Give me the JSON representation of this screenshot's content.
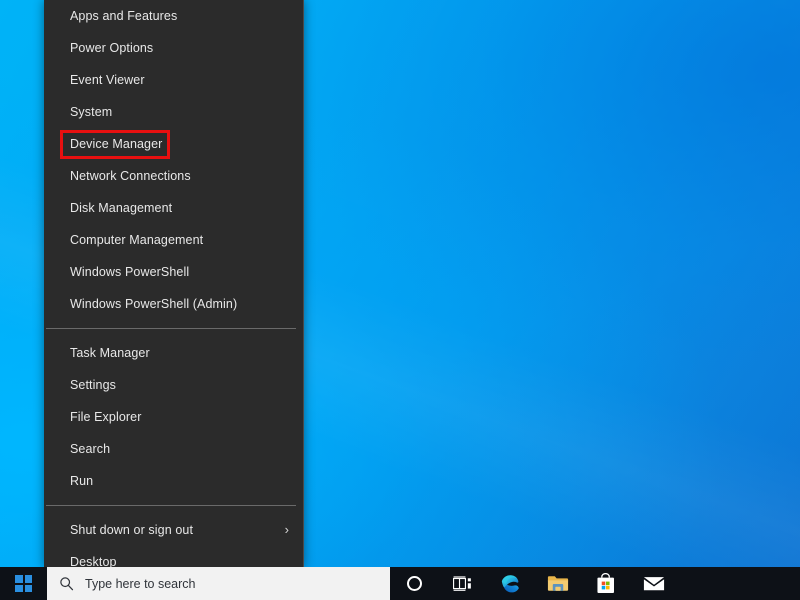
{
  "desktop": {
    "wallpaper_name": "windows-10-blue-gradient-wallpaper",
    "colors": {
      "bright_blue": "#00b3f7",
      "mid_blue": "#0498ec",
      "deep_blue": "#0f79d8"
    }
  },
  "winx_menu": {
    "name": "power-user-menu",
    "background_color": "#2b2b2b",
    "text_color": "#e8e8e8",
    "highlight": {
      "target_label": "Device Manager",
      "color": "#e81010",
      "border_width_px": 3
    },
    "groups": [
      {
        "items": [
          {
            "label": "Apps and Features",
            "has_submenu": false
          },
          {
            "label": "Power Options",
            "has_submenu": false
          },
          {
            "label": "Event Viewer",
            "has_submenu": false
          },
          {
            "label": "System",
            "has_submenu": false
          },
          {
            "label": "Device Manager",
            "has_submenu": false,
            "highlighted": true
          },
          {
            "label": "Network Connections",
            "has_submenu": false
          },
          {
            "label": "Disk Management",
            "has_submenu": false
          },
          {
            "label": "Computer Management",
            "has_submenu": false
          },
          {
            "label": "Windows PowerShell",
            "has_submenu": false
          },
          {
            "label": "Windows PowerShell (Admin)",
            "has_submenu": false
          }
        ]
      },
      {
        "items": [
          {
            "label": "Task Manager",
            "has_submenu": false
          },
          {
            "label": "Settings",
            "has_submenu": false
          },
          {
            "label": "File Explorer",
            "has_submenu": false
          },
          {
            "label": "Search",
            "has_submenu": false
          },
          {
            "label": "Run",
            "has_submenu": false
          }
        ]
      },
      {
        "items": [
          {
            "label": "Shut down or sign out",
            "has_submenu": true,
            "submenu_glyph": "›"
          },
          {
            "label": "Desktop",
            "has_submenu": false
          }
        ]
      }
    ]
  },
  "taskbar": {
    "background_color": "#0d1117",
    "start_button": {
      "icon": "windows-logo-icon",
      "label": "Start"
    },
    "search": {
      "icon": "search-icon",
      "placeholder": "Type here to search",
      "value": "",
      "background_color": "#f2f2f2"
    },
    "icons": [
      {
        "name": "cortana-icon",
        "label": "Cortana"
      },
      {
        "name": "task-view-icon",
        "label": "Task View"
      },
      {
        "name": "microsoft-edge-icon",
        "label": "Microsoft Edge"
      },
      {
        "name": "file-explorer-icon",
        "label": "File Explorer"
      },
      {
        "name": "microsoft-store-icon",
        "label": "Microsoft Store"
      },
      {
        "name": "mail-icon",
        "label": "Mail"
      }
    ]
  }
}
